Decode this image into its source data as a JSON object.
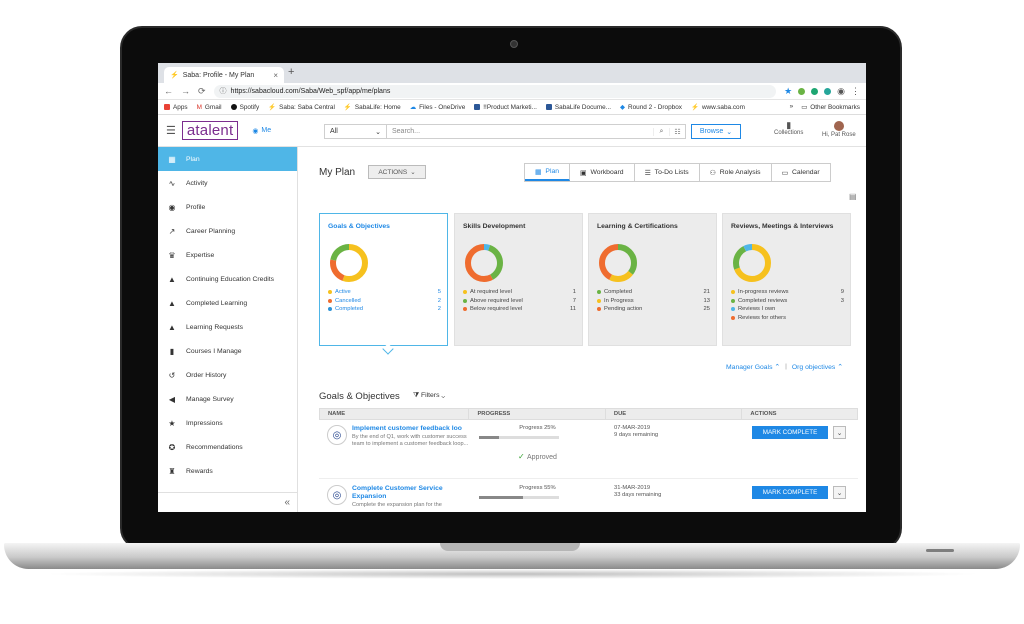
{
  "browser": {
    "tab_title": "Saba: Profile - My Plan",
    "url": "https://sabacloud.com/Saba/Web_spf/app/me/plans",
    "bookmarks": [
      "Apps",
      "Gmail",
      "Spotify",
      "Saba: Saba Central",
      "SabaLife: Home",
      "Files - OneDrive",
      "!!Product Marketi...",
      "SabaLife Docume...",
      "Round 2 - Dropbox",
      "www.saba.com"
    ],
    "bookmarks_more": "»",
    "other_bookmarks": "Other Bookmarks"
  },
  "header": {
    "logo": "atalent",
    "me_label": "Me",
    "search_scope": "All",
    "search_placeholder": "Search...",
    "browse_label": "Browse",
    "collections_label": "Collections",
    "user_label": "Hi, Pat Rose"
  },
  "sidebar": {
    "items": [
      {
        "label": "Plan",
        "icon": "▦"
      },
      {
        "label": "Activity",
        "icon": "∿"
      },
      {
        "label": "Profile",
        "icon": "◉"
      },
      {
        "label": "Career Planning",
        "icon": "↗"
      },
      {
        "label": "Expertise",
        "icon": "♛"
      },
      {
        "label": "Continuing Education Credits",
        "icon": "▲"
      },
      {
        "label": "Completed Learning",
        "icon": "▲"
      },
      {
        "label": "Learning Requests",
        "icon": "▲"
      },
      {
        "label": "Courses I Manage",
        "icon": "▮"
      },
      {
        "label": "Order History",
        "icon": "↺"
      },
      {
        "label": "Manage Survey",
        "icon": "◀"
      },
      {
        "label": "Impressions",
        "icon": "★"
      },
      {
        "label": "Recommendations",
        "icon": "✪"
      },
      {
        "label": "Rewards",
        "icon": "♜"
      }
    ],
    "collapse_icon": "«"
  },
  "main": {
    "title": "My Plan",
    "actions_label": "ACTIONS",
    "view_tabs": [
      {
        "label": "Plan",
        "icon": "▦"
      },
      {
        "label": "Workboard",
        "icon": "▣"
      },
      {
        "label": "To-Do Lists",
        "icon": "☰"
      },
      {
        "label": "Role Analysis",
        "icon": "⚇"
      },
      {
        "label": "Calendar",
        "icon": "▭"
      }
    ],
    "cards": [
      {
        "title": "Goals & Objectives",
        "segments": [
          {
            "label": "Active",
            "value": "5",
            "color": "#f6c11e"
          },
          {
            "label": "Cancelled",
            "value": "2",
            "color": "#ef6c2f"
          },
          {
            "label": "Completed",
            "value": "2",
            "color": "#2e93d6"
          }
        ],
        "ring": [
          {
            "v": 5,
            "c": "#f6c11e"
          },
          {
            "v": 2,
            "c": "#ef6c2f"
          },
          {
            "v": 2,
            "c": "#6ab344"
          }
        ]
      },
      {
        "title": "Skills Development",
        "segments": [
          {
            "label": "At required level",
            "value": "1",
            "color": "#f6c11e"
          },
          {
            "label": "Above required level",
            "value": "7",
            "color": "#6ab344"
          },
          {
            "label": "Below required level",
            "value": "11",
            "color": "#ef6c2f"
          }
        ],
        "ring": [
          {
            "v": 1,
            "c": "#4fb6e7"
          },
          {
            "v": 7,
            "c": "#6ab344"
          },
          {
            "v": 11,
            "c": "#ef6c2f"
          }
        ]
      },
      {
        "title": "Learning & Certifications",
        "segments": [
          {
            "label": "Completed",
            "value": "21",
            "color": "#6ab344"
          },
          {
            "label": "In Progress",
            "value": "13",
            "color": "#f6c11e"
          },
          {
            "label": "Pending action",
            "value": "25",
            "color": "#ef6c2f"
          }
        ],
        "ring": [
          {
            "v": 21,
            "c": "#6ab344"
          },
          {
            "v": 13,
            "c": "#f6c11e"
          },
          {
            "v": 25,
            "c": "#ef6c2f"
          }
        ]
      },
      {
        "title": "Reviews, Meetings & Interviews",
        "segments": [
          {
            "label": "In-progress reviews",
            "value": "9",
            "color": "#f6c11e"
          },
          {
            "label": "Completed reviews",
            "value": "3",
            "color": "#6ab344"
          },
          {
            "label": "Reviews I own",
            "value": "",
            "color": "#4fb6e7"
          },
          {
            "label": "Reviews for others",
            "value": "",
            "color": "#ef6c2f"
          }
        ],
        "ring": [
          {
            "v": 9,
            "c": "#f6c11e"
          },
          {
            "v": 3,
            "c": "#6ab344"
          },
          {
            "v": 1,
            "c": "#4fb6e7"
          }
        ]
      }
    ],
    "manager_goals": "Manager Goals",
    "org_objectives": "Org objectives",
    "section_title": "Goals & Objectives",
    "filters_label": "Filters",
    "columns": [
      "NAME",
      "PROGRESS",
      "DUE",
      "ACTIONS"
    ],
    "goals": [
      {
        "title": "Implement customer feedback loo",
        "desc": "By the end of Q1, work with customer success team to implement a customer feedback loop...",
        "progress_label": "Progress 25%",
        "progress": 0.25,
        "due_date": "07-MAR-2019",
        "due_remaining": "9 days remaining",
        "status": "Approved",
        "action": "MARK COMPLETE"
      },
      {
        "title": "Complete Customer Service Expansion",
        "desc": "Complete the expansion plan for the",
        "progress_label": "Progress 55%",
        "progress": 0.55,
        "due_date": "31-MAR-2019",
        "due_remaining": "33 days remaining",
        "status": "",
        "action": "MARK COMPLETE"
      }
    ]
  }
}
